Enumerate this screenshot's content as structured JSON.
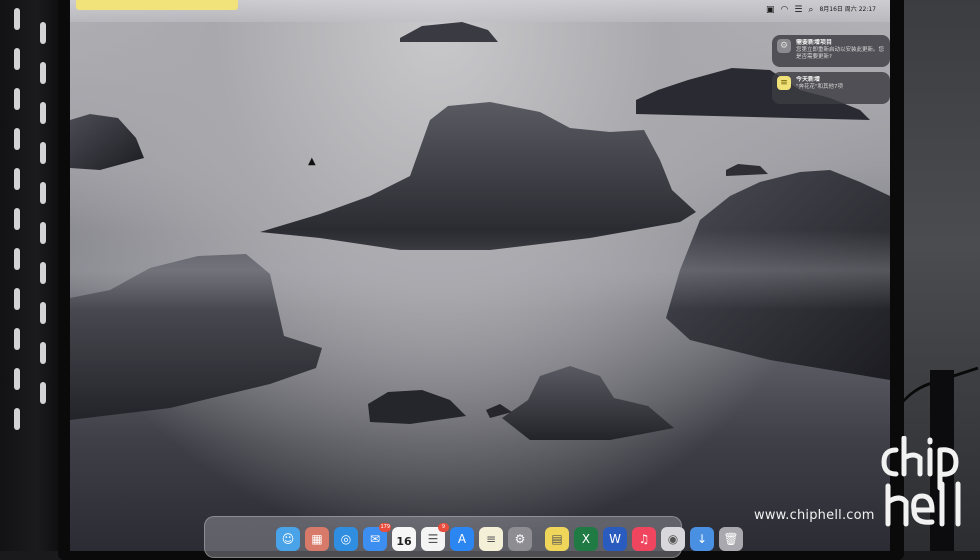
{
  "menubar": {
    "clock": "8月16日 周六  22:17",
    "accent_color": "#f2e27a"
  },
  "notifications": [
    {
      "title": "需要新增项目",
      "text": "您第立即重新启动以安装此更新。您是否需要更新?",
      "icon": "gear-icon",
      "icon_color": "#8a8a8f"
    },
    {
      "title": "今天新增",
      "text": "\"奔花花\"和其他7项",
      "icon": "notes-icon",
      "icon_color": "#f2e27a"
    }
  ],
  "dock": {
    "icons": [
      {
        "name": "finder-icon",
        "glyph": "☺",
        "color": "#4aa3e8"
      },
      {
        "name": "launchpad-icon",
        "glyph": "▦",
        "color": "#d87a6a"
      },
      {
        "name": "safari-icon",
        "glyph": "◎",
        "color": "#2f8ee0"
      },
      {
        "name": "mail-icon",
        "glyph": "✉",
        "color": "#3c8ef0",
        "badge": "179"
      },
      {
        "name": "calendar-icon",
        "glyph": "",
        "color": "#f7f7f7",
        "day": "16"
      },
      {
        "name": "reminders-icon",
        "glyph": "☰",
        "color": "#f4f4f4",
        "badge": "9"
      },
      {
        "name": "appstore-icon",
        "glyph": "A",
        "color": "#2c86f2"
      },
      {
        "name": "notes-icon",
        "glyph": "≡",
        "color": "#f4f0d8"
      },
      {
        "name": "system-settings-icon",
        "glyph": "⚙",
        "color": "#8d8d92"
      },
      {
        "name": "stickies-icon",
        "glyph": "▤",
        "color": "#efd65a"
      },
      {
        "name": "excel-icon",
        "glyph": "X",
        "color": "#1f7a44"
      },
      {
        "name": "word-icon",
        "glyph": "W",
        "color": "#2a5cbf"
      },
      {
        "name": "music-icon",
        "glyph": "♫",
        "color": "#f0455e"
      },
      {
        "name": "webcam-app-icon",
        "glyph": "◉",
        "color": "#d8d8dc"
      },
      {
        "name": "downloads-icon",
        "glyph": "↓",
        "color": "#4a90e2"
      },
      {
        "name": "trash-icon",
        "glyph": "🗑",
        "color": "#a8a8ae"
      }
    ]
  },
  "watermark": {
    "url": "www.chiphell.com",
    "logo_text": "chip hell"
  }
}
